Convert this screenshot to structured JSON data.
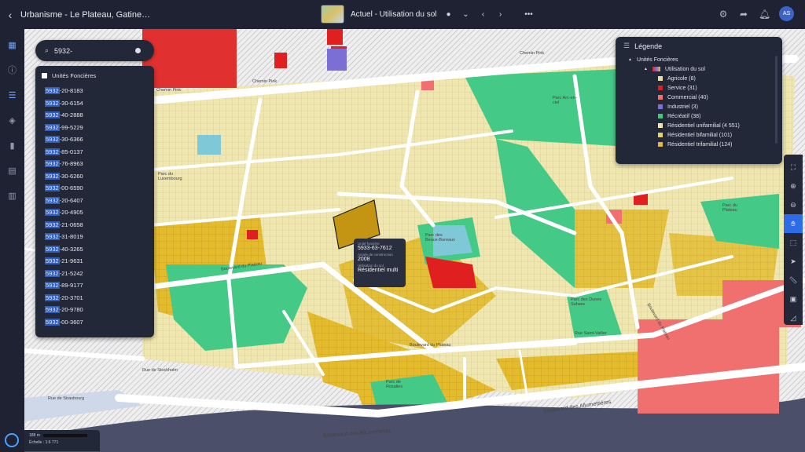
{
  "header": {
    "back_icon": "chevron-left-icon",
    "title": "Urbanisme - Le Plateau, Gatine…",
    "view_title": "Actuel - Utilisation du sol",
    "avatar": "AS"
  },
  "search": {
    "value": "5932-"
  },
  "results": {
    "header": "Unités Foncières",
    "query": "5932",
    "items": [
      "-20-8183",
      "-30-6154",
      "-40-2888",
      "-99-5229",
      "-30-6366",
      "-85-0137",
      "-76-8963",
      "-30-6260",
      "-00-6590",
      "-20-6407",
      "-20-4905",
      "-21-0658",
      "-31-8019",
      "-40-3265",
      "-21-9631",
      "-21-5242",
      "-89-9177",
      "-20-3701",
      "-20-9780",
      "-00-3607"
    ]
  },
  "legend": {
    "title": "Légende",
    "group": "Unités Foncières",
    "layer": "Utilisation du sol",
    "items": [
      {
        "label": "Agricole (8)",
        "color": "#e8d9a8"
      },
      {
        "label": "Service (31)",
        "color": "#e02020"
      },
      {
        "label": "Commercial (40)",
        "color": "#f07070"
      },
      {
        "label": "Industriel (3)",
        "color": "#7b6fd6"
      },
      {
        "label": "Récréatif (38)",
        "color": "#3ec97a"
      },
      {
        "label": "Résidentiel unifamilial (4 551)",
        "color": "#efe6b0"
      },
      {
        "label": "Résidentiel bifamilial (101)",
        "color": "#e8d070"
      },
      {
        "label": "Résidentiel trifamilial (124)",
        "color": "#e0b840"
      }
    ]
  },
  "popup": {
    "f1_label": "Unité foncière",
    "f1_value": "5933-63-7612",
    "f2_label": "Année de construction",
    "f2_value": "2008",
    "f3_label": "Utilisation du sol",
    "f3_value": "Résidentiel multi"
  },
  "scale": {
    "distance": "188 m",
    "ratio": "Échelle : 1:6 771"
  },
  "map_labels": {
    "chemin_pink_1": "Chemin Pink",
    "chemin_pink_2": "Chemin Pink",
    "chemin_pink_3": "Chemin Pink",
    "parc_luxembourg": "Parc du Luxembourg",
    "parc_des_beaux_bureaux": "Parc des Beaux-Bureaux",
    "parc_plateau": "Parc du Plateau",
    "parc_dunes": "Parc des Dunes Sahara",
    "parc_rosalies": "Parc de Rosalies",
    "parc_arc": "Parc Arc-en-ciel",
    "boul_plateau_1": "Boulevard du Plateau",
    "boul_plateau_2": "Boulevard du Plateau",
    "boul_plateau_3": "Boulevard du Plateau",
    "boul_allumettieres_1": "Boulevard des Allumettières",
    "boul_allumettieres_2": "Boulevard des Allumettières",
    "rue_stockholm": "Rue de Stockholm",
    "rue_strasbourg": "Rue de Strasbourg",
    "rue_saint_vallier": "Rue Saint-Vallier"
  }
}
